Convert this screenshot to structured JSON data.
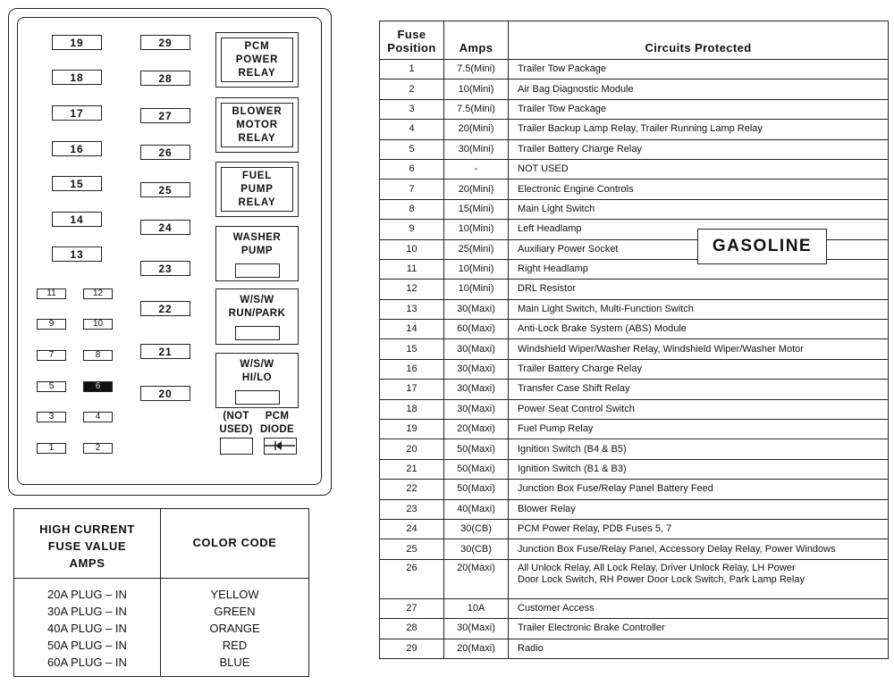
{
  "fuse_panel": {
    "large_fuses_left": [
      "19",
      "18",
      "17",
      "16",
      "15",
      "14",
      "13"
    ],
    "large_fuses_mid": [
      "29",
      "28",
      "27",
      "26",
      "25",
      "24",
      "23",
      "22",
      "21",
      "20"
    ],
    "mini_fuses": [
      {
        "left": "11",
        "right": "12"
      },
      {
        "left": "9",
        "right": "10"
      },
      {
        "left": "7",
        "right": "8"
      },
      {
        "left": "5",
        "right": "6"
      },
      {
        "left": "3",
        "right": "4"
      },
      {
        "left": "1",
        "right": "2"
      }
    ],
    "relays": {
      "pcm_power": [
        "PCM",
        "POWER",
        "RELAY"
      ],
      "blower_motor": [
        "BLOWER",
        "MOTOR",
        "RELAY"
      ],
      "fuel_pump": [
        "FUEL",
        "PUMP",
        "RELAY"
      ],
      "washer_pump": [
        "WASHER",
        "PUMP"
      ],
      "wsw_run_park": [
        "W/S/W",
        "RUN/PARK"
      ],
      "wsw_hi_lo": [
        "W/S/W",
        "HI/LO"
      ]
    },
    "not_used_label": [
      "(NOT",
      "USED)"
    ],
    "pcm_diode_label": [
      "PCM",
      "DIODE"
    ]
  },
  "color_code_table": {
    "header_left": [
      "HIGH CURRENT",
      "FUSE VALUE",
      "AMPS"
    ],
    "header_right": "COLOR CODE",
    "rows": [
      {
        "amps": "20A PLUG – IN",
        "color": "YELLOW"
      },
      {
        "amps": "30A PLUG – IN",
        "color": "GREEN"
      },
      {
        "amps": "40A PLUG – IN",
        "color": "ORANGE"
      },
      {
        "amps": "50A PLUG – IN",
        "color": "RED"
      },
      {
        "amps": "60A PLUG – IN",
        "color": "BLUE"
      }
    ]
  },
  "fuse_table": {
    "headers": {
      "position_line1": "Fuse",
      "position_line2": "Position",
      "amps": "Amps",
      "circuits": "Circuits Protected"
    },
    "rows": [
      {
        "pos": "1",
        "amps": "7.5(Mini)",
        "circuit": "Trailer Tow Package"
      },
      {
        "pos": "2",
        "amps": "10(Mini)",
        "circuit": "Air Bag Diagnostic Module"
      },
      {
        "pos": "3",
        "amps": "7.5(Mini)",
        "circuit": "Trailer Tow Package"
      },
      {
        "pos": "4",
        "amps": "20(Mini)",
        "circuit": "Trailer Backup Lamp Relay, Trailer Running Lamp Relay"
      },
      {
        "pos": "5",
        "amps": "30(Mini)",
        "circuit": "Trailer Battery Charge Relay"
      },
      {
        "pos": "6",
        "amps": "-",
        "circuit": "NOT USED"
      },
      {
        "pos": "7",
        "amps": "20(Mini)",
        "circuit": "Electronic Engine Controls"
      },
      {
        "pos": "8",
        "amps": "15(Mini)",
        "circuit": "Main Light Switch"
      },
      {
        "pos": "9",
        "amps": "10(Mini)",
        "circuit": "Left Headlamp"
      },
      {
        "pos": "10",
        "amps": "25(Mini)",
        "circuit": "Auxiliary Power Socket"
      },
      {
        "pos": "11",
        "amps": "10(Mini)",
        "circuit": "Right Headlamp"
      },
      {
        "pos": "12",
        "amps": "10(Mini)",
        "circuit": "DRL Resistor"
      },
      {
        "pos": "13",
        "amps": "30(Maxi)",
        "circuit": "Main Light Switch, Multi-Function Switch"
      },
      {
        "pos": "14",
        "amps": "60(Maxi)",
        "circuit": "Anti-Lock Brake System (ABS) Module"
      },
      {
        "pos": "15",
        "amps": "30(Maxi)",
        "circuit": "Windshield Wiper/Washer Relay, Windshield Wiper/Washer Motor"
      },
      {
        "pos": "16",
        "amps": "30(Maxi)",
        "circuit": "Trailer Battery Charge Relay"
      },
      {
        "pos": "17",
        "amps": "30(Maxi)",
        "circuit": "Transfer Case Shift Relay"
      },
      {
        "pos": "18",
        "amps": "30(Maxi)",
        "circuit": "Power Seat Control Switch"
      },
      {
        "pos": "19",
        "amps": "20(Maxi)",
        "circuit": "Fuel Pump Relay"
      },
      {
        "pos": "20",
        "amps": "50(Maxi)",
        "circuit": "Ignition Switch (B4 & B5)"
      },
      {
        "pos": "21",
        "amps": "50(Maxi)",
        "circuit": "Ignition Switch (B1 & B3)"
      },
      {
        "pos": "22",
        "amps": "50(Maxi)",
        "circuit": "Junction Box Fuse/Relay Panel Battery Feed"
      },
      {
        "pos": "23",
        "amps": "40(Maxi)",
        "circuit": "Blower Relay"
      },
      {
        "pos": "24",
        "amps": "30(CB)",
        "circuit": "PCM Power Relay, PDB Fuses 5, 7"
      },
      {
        "pos": "25",
        "amps": "30(CB)",
        "circuit": "Junction Box Fuse/Relay Panel, Accessory Delay Relay, Power Windows"
      },
      {
        "pos": "26",
        "amps": "20(Maxi)",
        "circuit": "All Unlock Relay, All Lock Relay, Driver Unlock Relay, LH Power",
        "circuit_line2": "Door Lock Switch, RH Power Door Lock Switch, Park Lamp Relay"
      },
      {
        "pos": "27",
        "amps": "10A",
        "circuit": "Customer Access"
      },
      {
        "pos": "28",
        "amps": "30(Maxi)",
        "circuit": "Trailer Electronic Brake Controller"
      },
      {
        "pos": "29",
        "amps": "20(Maxi)",
        "circuit": "Radio"
      }
    ]
  },
  "badge": {
    "label": "GASOLINE"
  }
}
